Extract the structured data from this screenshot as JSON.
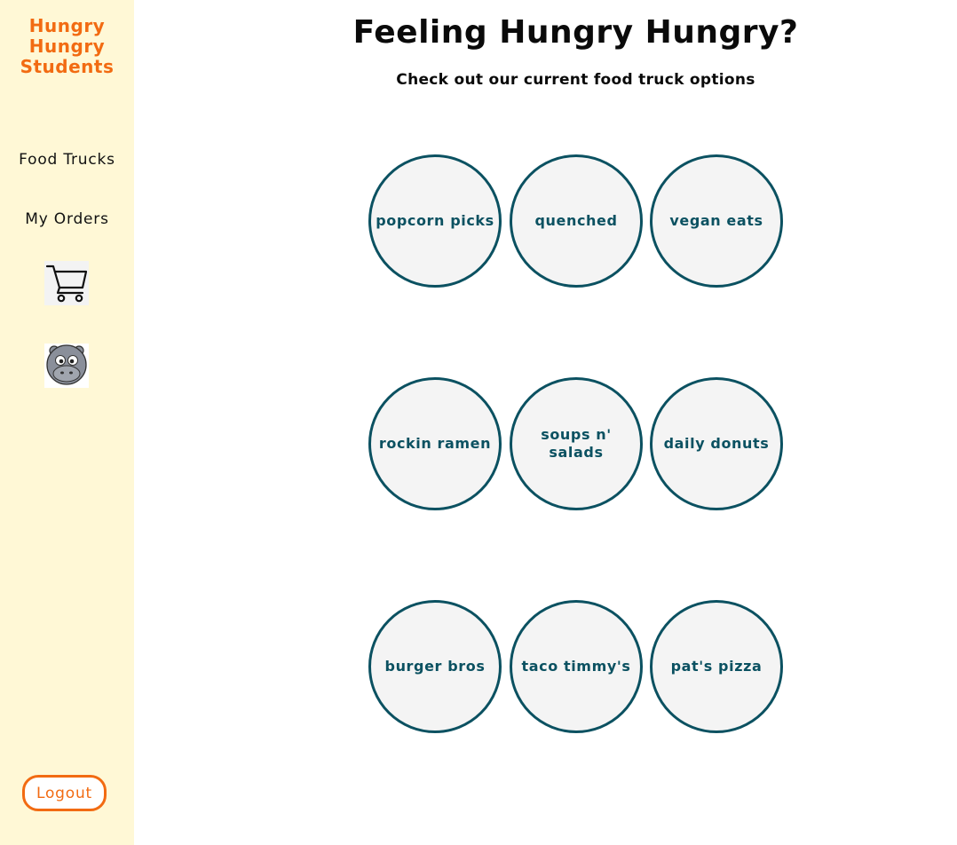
{
  "brand": {
    "line1": "Hungry",
    "line2": "Hungry",
    "line3": "Students",
    "color": "#f26b12"
  },
  "sidebar": {
    "background": "#fff8d6",
    "nav": [
      {
        "label": "Food Trucks"
      },
      {
        "label": "My Orders"
      }
    ],
    "cart_icon": "shopping-cart-icon",
    "avatar_icon": "hippo-avatar-icon",
    "logout_label": "Logout"
  },
  "main": {
    "title": "Feeling Hungry Hungry?",
    "subtitle": "Check out our current food truck options",
    "trucks": [
      {
        "name": "popcorn picks"
      },
      {
        "name": "quenched"
      },
      {
        "name": "vegan eats"
      },
      {
        "name": "rockin ramen"
      },
      {
        "name": "soups n' salads"
      },
      {
        "name": "daily donuts"
      },
      {
        "name": "burger bros"
      },
      {
        "name": "taco timmy's"
      },
      {
        "name": "pat's pizza"
      }
    ],
    "accent": "#0b5161"
  }
}
